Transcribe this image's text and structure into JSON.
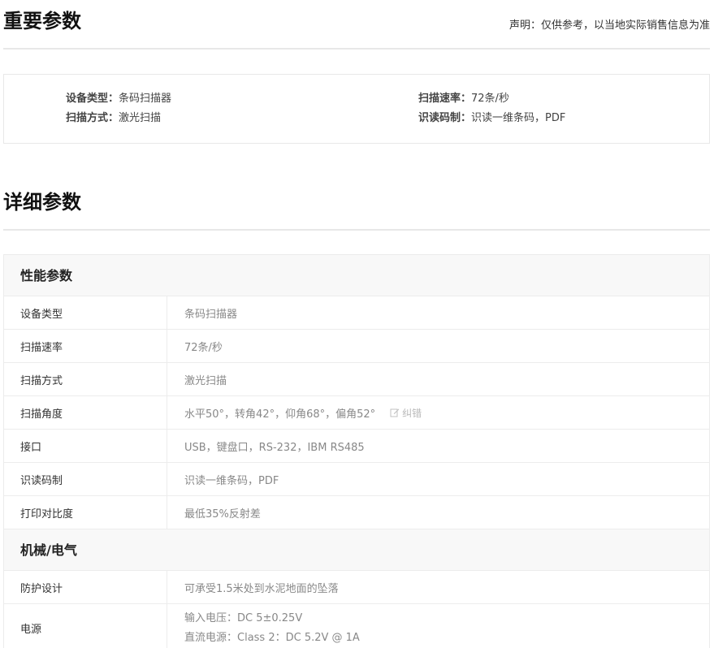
{
  "important": {
    "title": "重要参数",
    "disclaimer": "声明：仅供参考，以当地实际销售信息为准",
    "items": [
      {
        "key": "设备类型：",
        "value": "条码扫描器"
      },
      {
        "key": "扫描方式：",
        "value": "激光扫描"
      },
      {
        "key": "扫描速率：",
        "value": "72条/秒"
      },
      {
        "key": "识读码制：",
        "value": "识读一维条码，PDF"
      }
    ]
  },
  "detail": {
    "title": "详细参数",
    "groups": [
      {
        "name": "性能参数",
        "rows": [
          {
            "label": "设备类型",
            "value": "条码扫描器"
          },
          {
            "label": "扫描速率",
            "value": "72条/秒"
          },
          {
            "label": "扫描方式",
            "value": "激光扫描"
          },
          {
            "label": "扫描角度",
            "value": "水平50°，转角42°，仰角68°，偏角52°",
            "correct": "纠错"
          },
          {
            "label": "接口",
            "value": "USB，键盘口，RS-232，IBM RS485"
          },
          {
            "label": "识读码制",
            "value": "识读一维条码，PDF"
          },
          {
            "label": "打印对比度",
            "value": "最低35%反射差"
          }
        ]
      },
      {
        "name": "机械/电气",
        "rows": [
          {
            "label": "防护设计",
            "value": "可承受1.5米处到水泥地面的坠落"
          },
          {
            "label": "电源",
            "lines": [
              "输入电压：DC 5±0.25V",
              "直流电源：Class 2：DC 5.2V @ 1A"
            ]
          }
        ]
      }
    ]
  }
}
